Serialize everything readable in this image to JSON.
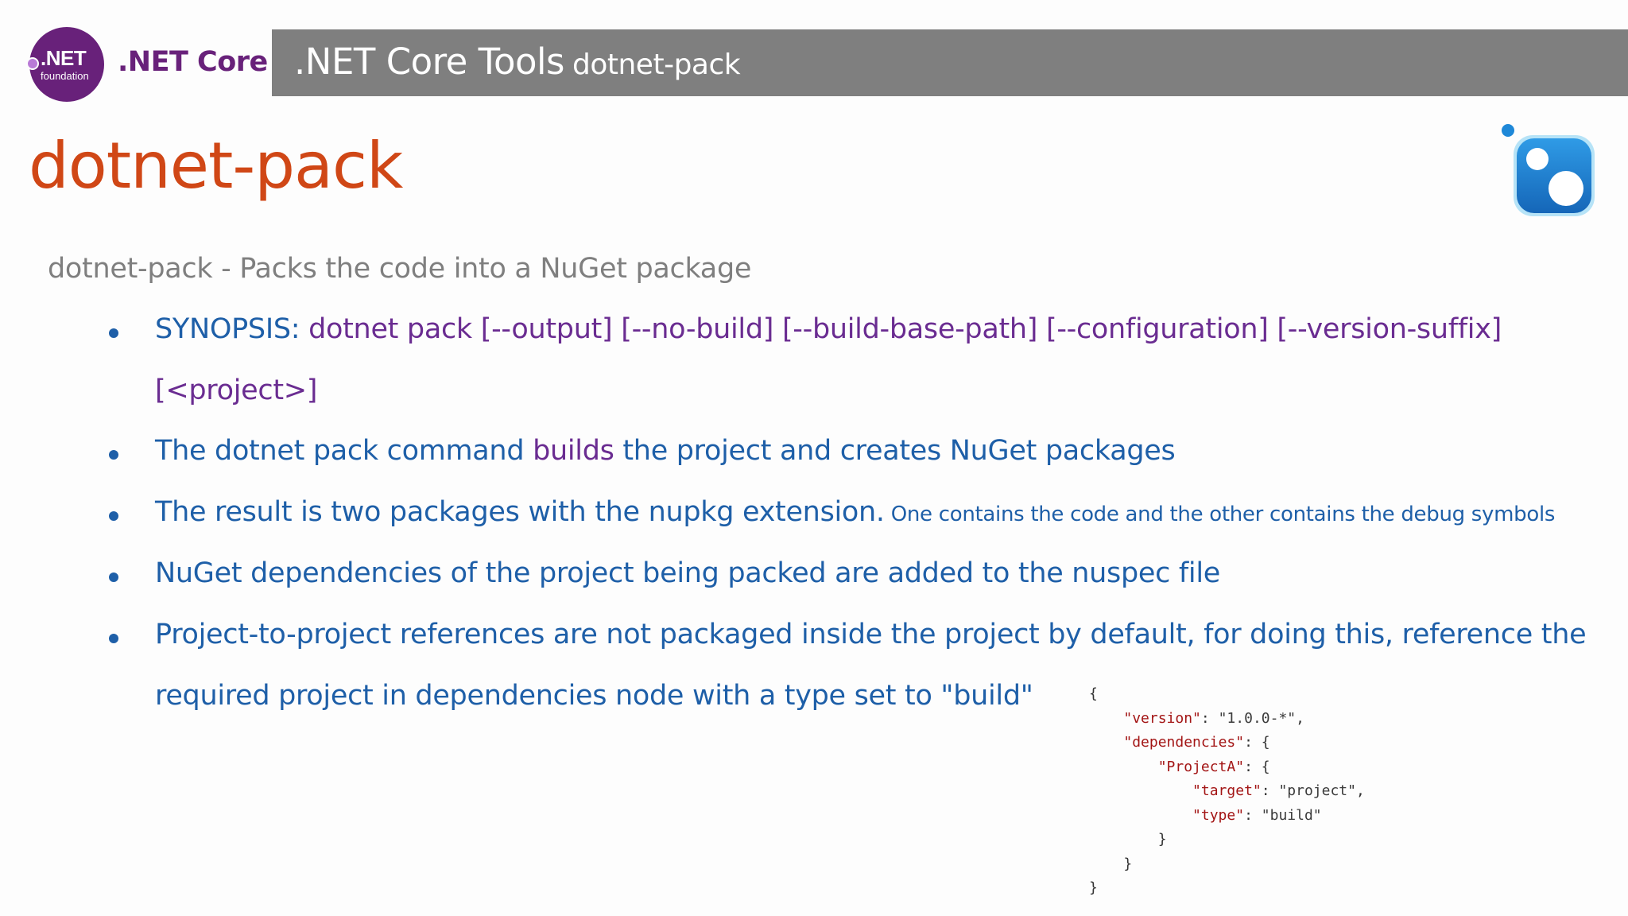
{
  "logo": {
    "net_text": ".NET",
    "foundation_text": "foundation"
  },
  "brand": ".NET Core",
  "header": {
    "title": ".NET Core Tools",
    "subtitle": "dotnet-pack"
  },
  "page_title": "dotnet-pack",
  "intro": "dotnet-pack - Packs the code into a NuGet package",
  "bullets": {
    "synopsis_label": "SYNOPSIS:",
    "synopsis_line1": " dotnet pack [--output] [--no-build] [--build-base-path] [--configuration] [--version-suffix]",
    "synopsis_line2": "[<project>]",
    "b2_part1": "The dotnet pack command ",
    "b2_highlight": "builds",
    "b2_part2": " the project and creates NuGet packages",
    "b3_main": "The result is two packages with the nupkg extension.",
    "b3_small": " One contains the code and the other contains the debug symbols",
    "b4": "NuGet dependencies of the project being packed are added to the nuspec file",
    "b5_line1": "Project-to-project references are not packaged inside the project by default, for doing this, reference the",
    "b5_line2": "required project in dependencies node with a type set to \"build\""
  },
  "code": {
    "open": "{",
    "version_key": "\"version\"",
    "version_val": "\"1.0.0-*\"",
    "dependencies_key": "\"dependencies\"",
    "project_key": "\"ProjectA\"",
    "target_key": "\"target\"",
    "target_val": "\"project\"",
    "type_key": "\"type\"",
    "type_val": "\"build\"",
    "close": "}"
  },
  "colors": {
    "title": "#d04716",
    "bullet_blue": "#1e5fa8",
    "purple": "#6a2c91",
    "header_bar": "#7f7f7f",
    "nuget_blue": "#1e7fd0"
  }
}
